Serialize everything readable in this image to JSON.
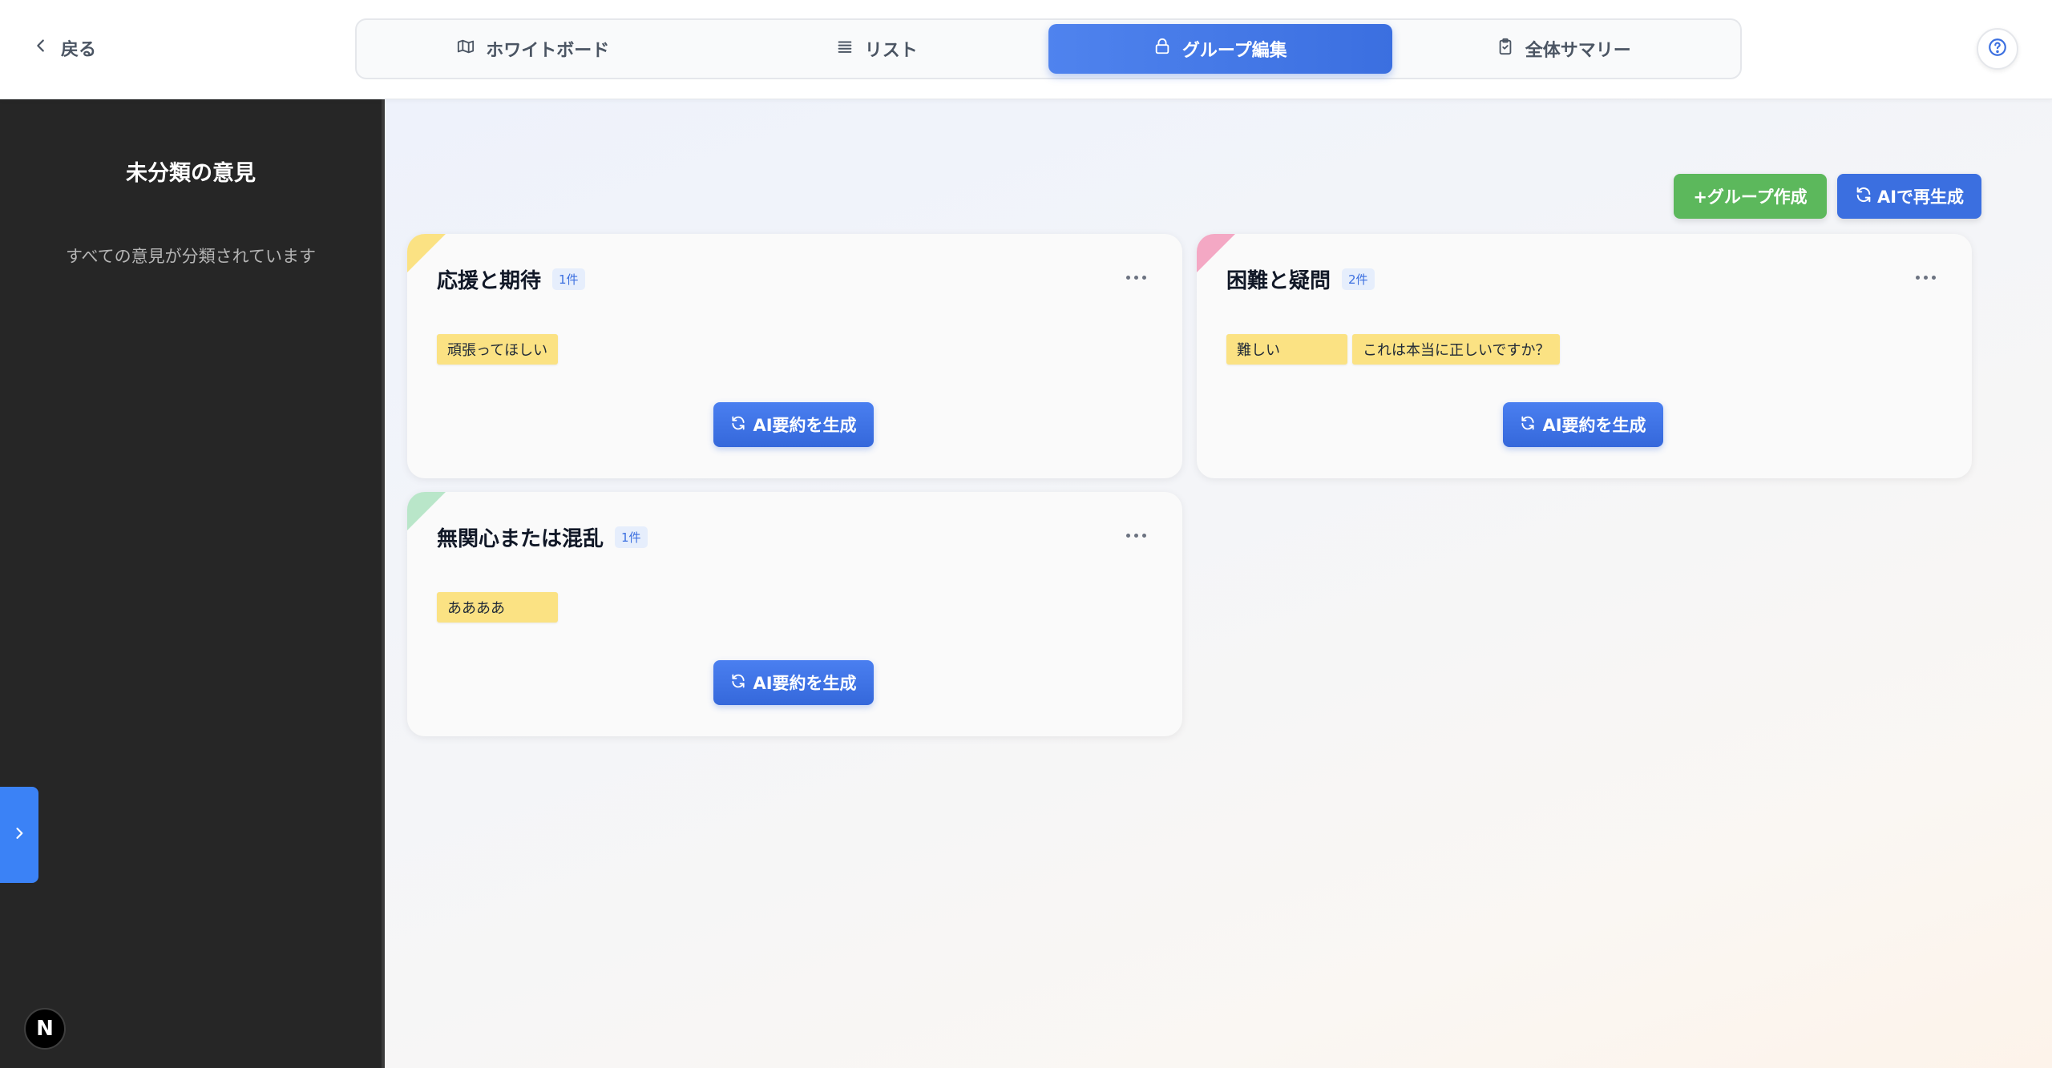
{
  "header": {
    "back_label": "戻る",
    "tabs": [
      {
        "label": "ホワイトボード",
        "icon": "map-icon",
        "active": false
      },
      {
        "label": "リスト",
        "icon": "list-icon",
        "active": false
      },
      {
        "label": "グループ編集",
        "icon": "lock-icon",
        "active": true
      },
      {
        "label": "全体サマリー",
        "icon": "clipboard-check-icon",
        "active": false
      }
    ],
    "help_icon": "help-circle-icon"
  },
  "sidebar": {
    "title": "未分類の意見",
    "empty_message": "すべての意見が分類されています",
    "toggle_icon": "chevron-right-icon",
    "badge_letter": "N"
  },
  "toolbar": {
    "create_group_label": "+グループ作成",
    "regenerate_label": "AIで再生成"
  },
  "groups": [
    {
      "title": "応援と期待",
      "count": "1件",
      "corner_color": "#fbe283",
      "notes": [
        "頑張ってほしい"
      ],
      "summary_button": "AI要約を生成"
    },
    {
      "title": "困難と疑問",
      "count": "2件",
      "corner_color": "#f4a8c4",
      "notes": [
        "難しい",
        "これは本当に正しいですか？"
      ],
      "summary_button": "AI要約を生成"
    },
    {
      "title": "無関心または混乱",
      "count": "1件",
      "corner_color": "#b9e6c9",
      "notes": [
        "ああああ"
      ],
      "summary_button": "AI要約を生成"
    }
  ],
  "colors": {
    "accent": "#3b6fe0",
    "create_green": "#5cb85c",
    "sidebar_bg": "#262626",
    "note_yellow": "#fbe283"
  }
}
